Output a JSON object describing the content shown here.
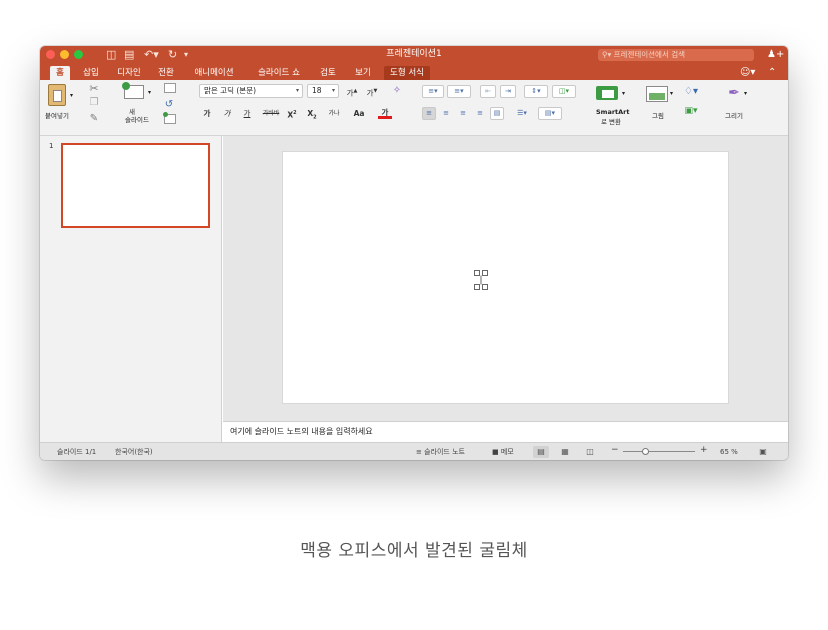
{
  "window": {
    "title": "프레젠테이션1"
  },
  "titlebar": {
    "quick_icons": [
      "sidebar-toggle-icon",
      "save-icon",
      "undo-icon",
      "redo-icon",
      "customize-icon"
    ],
    "search_placeholder": "프레젠테이션에서 검색"
  },
  "tabs": [
    {
      "label": "홈",
      "state": "active"
    },
    {
      "label": "삽입"
    },
    {
      "label": "디자인"
    },
    {
      "label": "전환"
    },
    {
      "label": "애니메이션"
    },
    {
      "label": "슬라이드 쇼"
    },
    {
      "label": "검토"
    },
    {
      "label": "보기"
    },
    {
      "label": "도형 서식",
      "state": "contextual"
    }
  ],
  "ribbon": {
    "paste_label": "붙여넣기",
    "new_slide_label_1": "새",
    "new_slide_label_2": "슬라이드",
    "font_name": "맑은 고딕 (본문)",
    "font_size": "18",
    "grow_font": "가",
    "shrink_font": "가",
    "bold": "가",
    "italic": "가",
    "underline": "가",
    "strike": "가바바",
    "superscript": "X",
    "subscript": "X",
    "spacing": "가나",
    "case": "Aa",
    "font_color": "가",
    "smartart_label_1": "SmartArt",
    "smartart_label_2": "로 변환",
    "picture_label": "그림",
    "draw_label": "그리기"
  },
  "thumbnails": {
    "number": "1"
  },
  "notes": {
    "placeholder": "여기에 슬라이드 노트의 내용을 입력하세요"
  },
  "statusbar": {
    "slide_count": "슬라이드 1/1",
    "language": "한국어(한국)",
    "notes_button": "슬라이드 노트",
    "comments_button": "메모",
    "zoom": "65 %",
    "zoom_level_percent": 65
  },
  "caption": "맥용 오피스에서 발견된 굴림체",
  "colors": {
    "accent": "#c34e2f",
    "selection": "#d24726"
  }
}
